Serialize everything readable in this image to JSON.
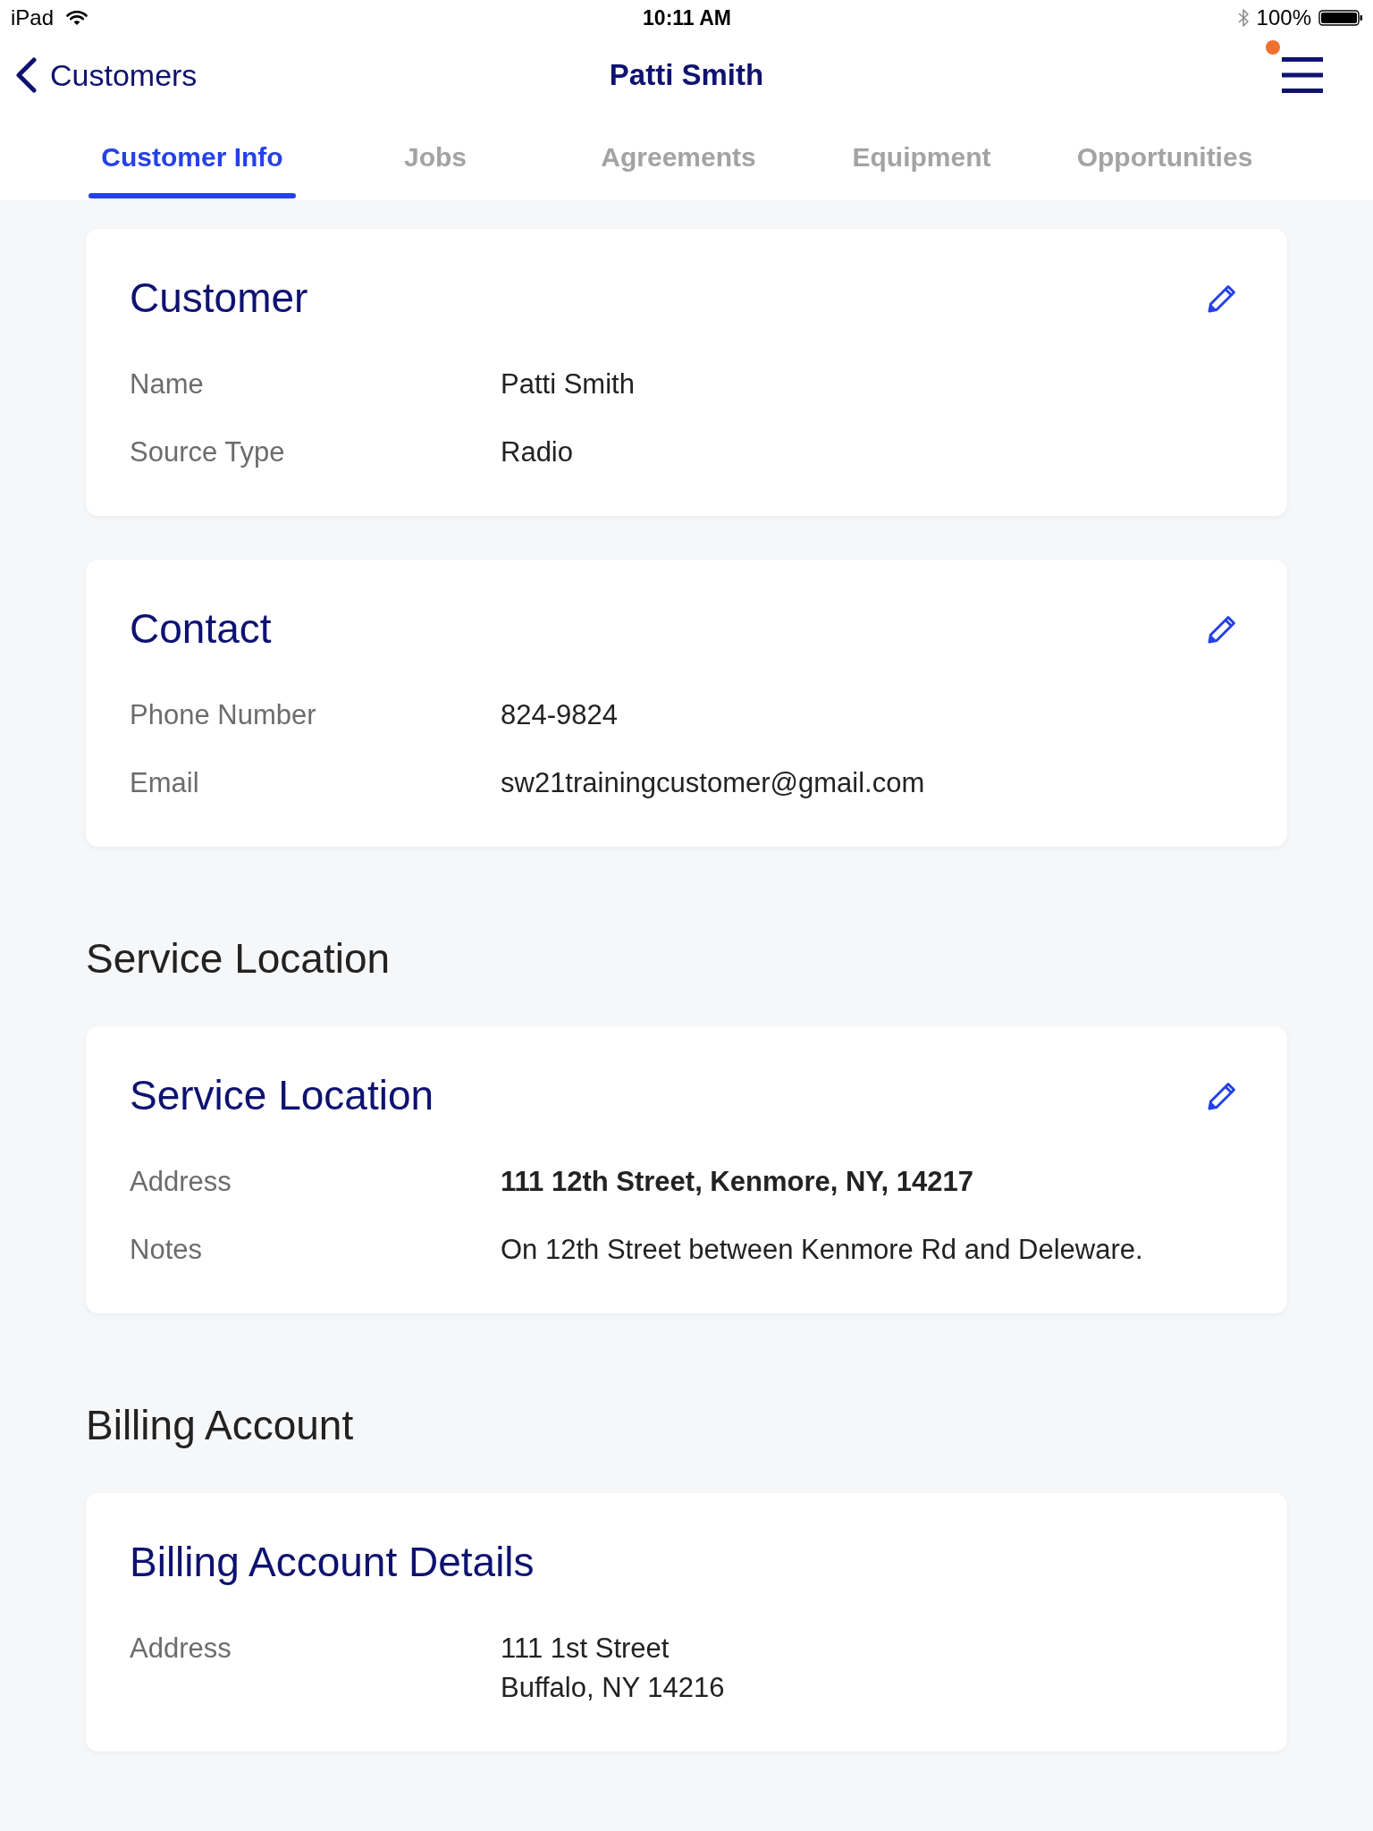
{
  "status_bar": {
    "device": "iPad",
    "time": "10:11 AM",
    "battery": "100%"
  },
  "nav_bar": {
    "back_label": "Customers",
    "title": "Patti Smith",
    "menu_notification": true
  },
  "tabs": [
    {
      "label": "Customer Info",
      "selected": true
    },
    {
      "label": "Jobs",
      "selected": false
    },
    {
      "label": "Agreements",
      "selected": false
    },
    {
      "label": "Equipment",
      "selected": false
    },
    {
      "label": "Opportunities",
      "selected": false
    }
  ],
  "content": [
    {
      "kind": "card",
      "title": "Customer",
      "editable": true,
      "fields": [
        {
          "label": "Name",
          "value": "Patti Smith",
          "emphasized": false
        },
        {
          "label": "Source Type",
          "value": "Radio",
          "emphasized": false
        }
      ]
    },
    {
      "kind": "card",
      "title": "Contact",
      "editable": true,
      "fields": [
        {
          "label": "Phone Number",
          "value": "824-9824",
          "emphasized": false
        },
        {
          "label": "Email",
          "value": "sw21trainingcustomer@gmail.com",
          "emphasized": false
        }
      ]
    },
    {
      "kind": "heading",
      "text": "Service Location"
    },
    {
      "kind": "card",
      "title": "Service Location",
      "editable": true,
      "fields": [
        {
          "label": "Address",
          "value": "111 12th Street, Kenmore, NY, 14217",
          "emphasized": true
        },
        {
          "label": "Notes",
          "value": "On 12th Street between Kenmore Rd and Deleware.",
          "emphasized": false
        }
      ]
    },
    {
      "kind": "heading",
      "text": "Billing Account"
    },
    {
      "kind": "card",
      "title": "Billing Account Details",
      "editable": false,
      "fields": [
        {
          "label": "Address",
          "value_lines": [
            "111 1st Street",
            "Buffalo, NY 14216"
          ],
          "emphasized": false
        }
      ]
    }
  ]
}
